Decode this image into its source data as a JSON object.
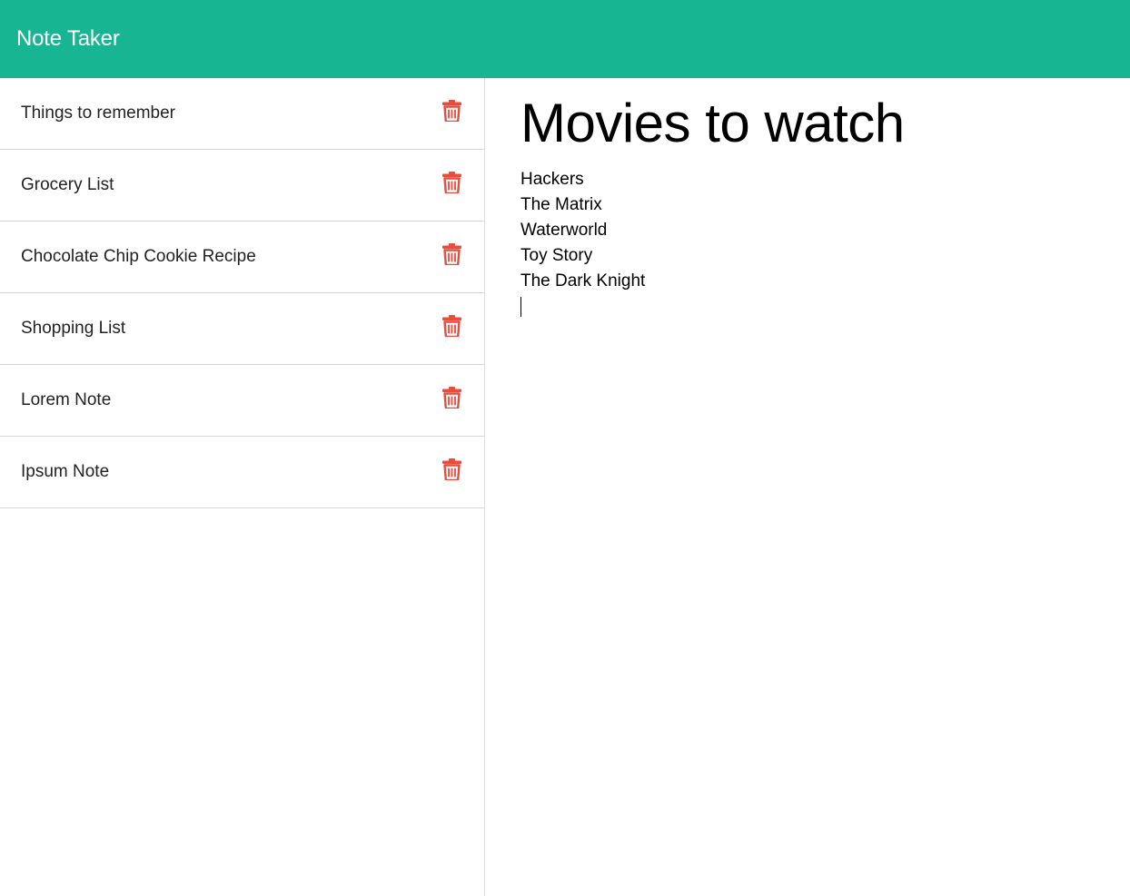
{
  "app": {
    "brand": "Note Taker"
  },
  "colors": {
    "navbar": "#18b592",
    "delete_icon": "#e74c3c"
  },
  "notes": [
    {
      "title": "Things to remember",
      "icon": "trash-icon"
    },
    {
      "title": "Grocery List",
      "icon": "trash-icon"
    },
    {
      "title": "Chocolate Chip Cookie Recipe",
      "icon": "trash-icon"
    },
    {
      "title": "Shopping List",
      "icon": "trash-icon"
    },
    {
      "title": "Lorem Note",
      "icon": "trash-icon"
    },
    {
      "title": "Ipsum Note",
      "icon": "trash-icon"
    }
  ],
  "active_note": {
    "title": "Movies to watch",
    "body_lines": [
      "Hackers",
      "The Matrix",
      "Waterworld",
      "Toy Story",
      "The Dark Knight"
    ]
  }
}
